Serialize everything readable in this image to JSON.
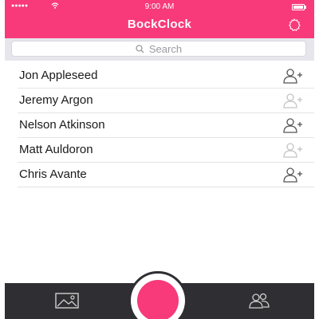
{
  "status": {
    "time": "9:00 AM",
    "signal": "●●●●●"
  },
  "header": {
    "title": "BockClock"
  },
  "search": {
    "placeholder": "Search"
  },
  "contacts": [
    {
      "name": "Jon Appleseed",
      "added": true
    },
    {
      "name": "Jeremy Argon",
      "added": false
    },
    {
      "name": "Nelson Atkinson",
      "added": true
    },
    {
      "name": "Matt Auldoron",
      "added": false
    },
    {
      "name": "Chris Avante",
      "added": true
    }
  ],
  "tabbar": {
    "left_icon": "photo-gallery-icon",
    "center": "record-button",
    "right_icon": "contacts-group-icon"
  },
  "colors": {
    "accent": "#f8397a",
    "tabbar": "#2f2f33",
    "icon_active": "#555555",
    "icon_inactive": "#c4c4c4"
  }
}
